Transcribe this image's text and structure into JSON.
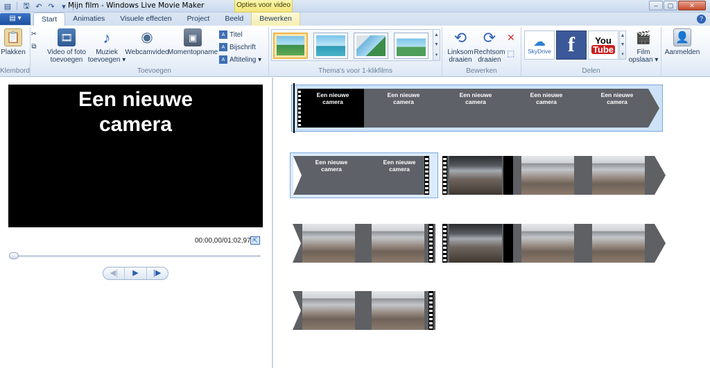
{
  "window": {
    "title": "Mijn film - Windows Live Movie Maker",
    "context_tab_group": "Opties voor video",
    "controls": [
      "–",
      "▢",
      "✕"
    ]
  },
  "tabs": [
    {
      "label": "Start",
      "active": true
    },
    {
      "label": "Animaties"
    },
    {
      "label": "Visuele effecten"
    },
    {
      "label": "Project"
    },
    {
      "label": "Beeld"
    },
    {
      "label": "Bewerken",
      "context": true
    }
  ],
  "ribbon": {
    "klembord": {
      "label": "Klembord",
      "plakken": "Plakken"
    },
    "toevoegen": {
      "label": "Toevoegen",
      "video_foto": [
        "Video of foto",
        "toevoegen"
      ],
      "muziek": [
        "Muziek",
        "toevoegen ▾"
      ],
      "webcam": "Webcamvideo",
      "moment": "Momentopname",
      "titel": "Titel",
      "bijschrift": "Bijschrift",
      "aftiteling": "Aftiteling ▾"
    },
    "themas": {
      "label": "Thema's voor 1-klikfilms"
    },
    "bewerken": {
      "label": "Bewerken",
      "links": [
        "Linksom",
        "draaien"
      ],
      "rechts": [
        "Rechtsom",
        "draaien"
      ]
    },
    "delen": {
      "label": "Delen",
      "skydrive": "SkyDrive",
      "youtube": [
        "You",
        "Tube"
      ],
      "film": [
        "Film",
        "opslaan ▾"
      ]
    },
    "aanmelden": "Aanmelden"
  },
  "preview": {
    "caption_line1": "Een nieuwe",
    "caption_line2": "camera",
    "timecode": "00:00,00/01:02,97",
    "progress": 0
  },
  "storyboard": {
    "caption_line1": "Een nieuwe",
    "caption_line2": "camera"
  },
  "colors": {
    "accent": "#2e62b4",
    "selected_theme": "#f0b64a",
    "context_tab": "#f3e67a"
  }
}
